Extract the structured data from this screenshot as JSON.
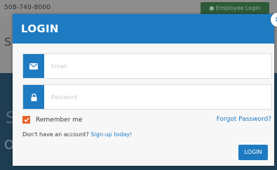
{
  "background": {
    "phone": "508-740-8000",
    "employee_login": "Employee Login",
    "partial_letter_1": "S",
    "partial_letter_2": "S",
    "partial_letter_3": "O"
  },
  "modal": {
    "title": "LOGIN",
    "close_label": "×",
    "email_placeholder": "Email",
    "password_placeholder": "Password",
    "remember_label": "Remember me",
    "remember_checked": true,
    "forgot_label": "Forgot Password?",
    "signup_prompt": "Don't have an account?",
    "signup_link": "Sign-up today!",
    "login_button": "LOGIN"
  },
  "colors": {
    "accent_blue": "#1e7bc2",
    "checkbox_orange": "#e8632b"
  },
  "icons": {
    "email": "envelope-icon",
    "password": "lock-icon",
    "close": "close-icon",
    "checkbox": "checkmark-icon",
    "employee": "user-icon"
  }
}
